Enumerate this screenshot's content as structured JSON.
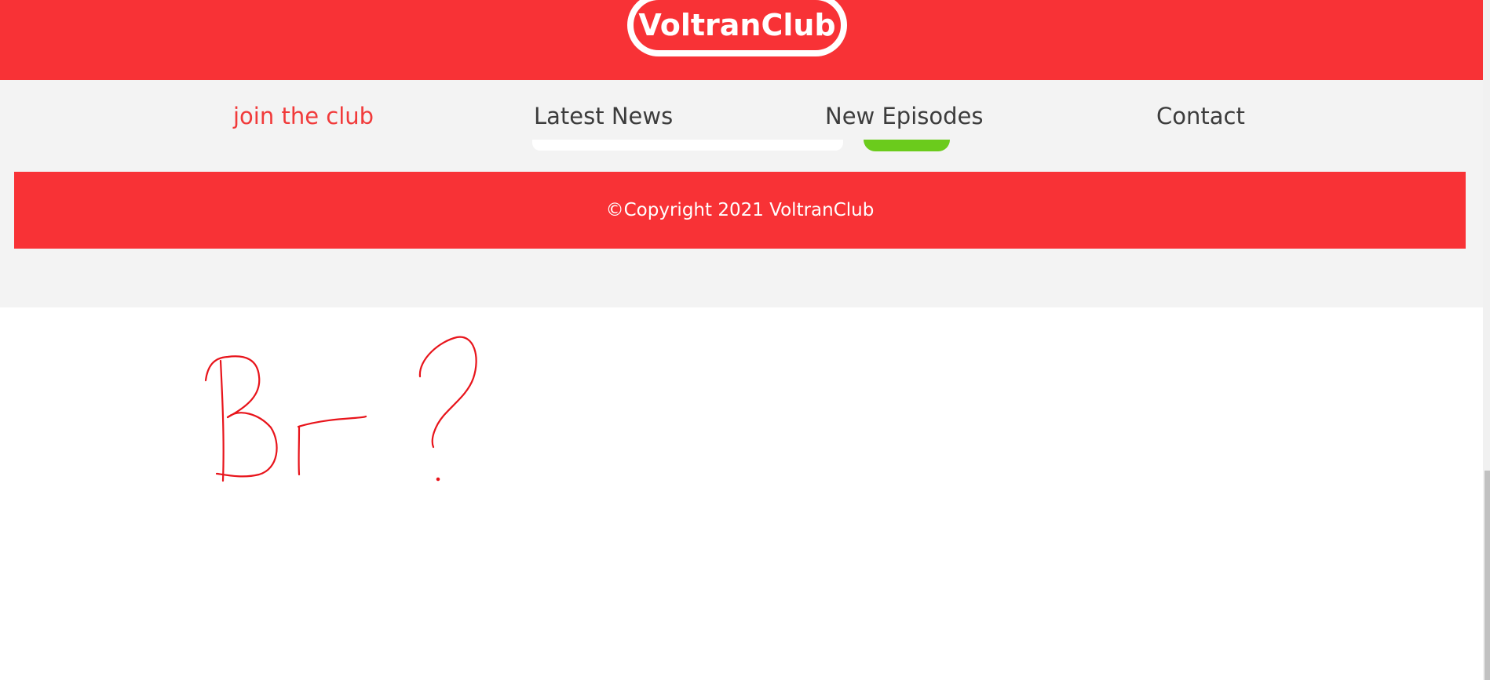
{
  "header": {
    "logo_text": "VoltranClub",
    "bg_color": "#f83236"
  },
  "nav": {
    "items": [
      {
        "label": "join the club",
        "active": true
      },
      {
        "label": "Latest News",
        "active": false
      },
      {
        "label": "New Episodes",
        "active": false
      },
      {
        "label": "Contact",
        "active": false
      }
    ],
    "active_color": "#f13a3a",
    "text_color": "#3c3c3c",
    "indicator_color": "#6bcb1c"
  },
  "footer": {
    "copyright": "©Copyright 2021 VoltranClub",
    "bg_color": "#f83236"
  },
  "annotation": {
    "text": "Br ?",
    "color": "#e8141b"
  }
}
